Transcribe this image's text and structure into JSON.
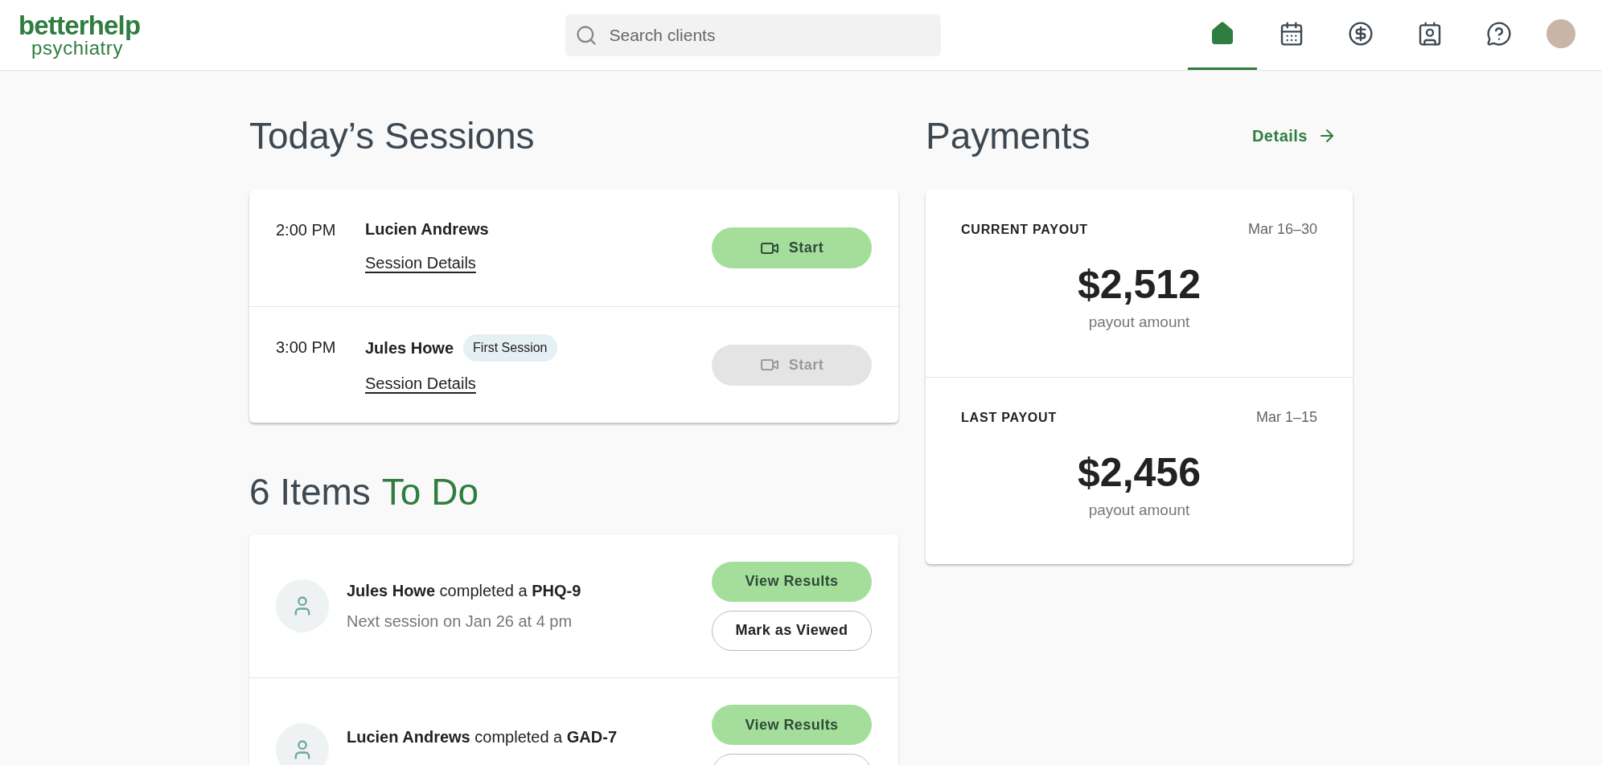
{
  "header": {
    "logo": {
      "line1": "betterhelp",
      "line2": "psychiatry"
    },
    "search": {
      "placeholder": "Search clients"
    },
    "nav": [
      {
        "kind": "home",
        "selected": true
      },
      {
        "kind": "calendar",
        "selected": false
      },
      {
        "kind": "dollar",
        "selected": false
      },
      {
        "kind": "contact",
        "selected": false
      },
      {
        "kind": "help",
        "selected": false
      },
      {
        "kind": "avatar",
        "selected": false
      }
    ]
  },
  "sessions": {
    "title": "Today’s Sessions",
    "rows": [
      {
        "time": "2:00 PM",
        "name": "Lucien Andrews",
        "link": "Session Details",
        "button": "Start",
        "enabled": true
      },
      {
        "time": "3:00 PM",
        "name": "Jules Howe",
        "badge": "First Session",
        "link": "Session Details",
        "button": "Start",
        "enabled": false
      }
    ]
  },
  "todo": {
    "count": "6 Items",
    "title": "To Do",
    "items": [
      {
        "text": "**Jules Howe** completed a **PHQ-9**",
        "subtitle": "Next session on Jan 26 at 4 pm",
        "actions": [
          {
            "kind": "primary",
            "label": "View Results"
          },
          {
            "kind": "secondary",
            "label": "Mark as Viewed"
          }
        ]
      },
      {
        "text": "**Lucien Andrews** completed a **GAD-7**",
        "actions": [
          {
            "kind": "primary",
            "label": "View Results"
          },
          {
            "kind": "secondary"
          }
        ]
      }
    ]
  },
  "payments": {
    "title": "Payments",
    "details_link": "Details",
    "sections": [
      {
        "label": "CURRENT PAYOUT",
        "period": "Mar 16–30",
        "amount": "$2,512",
        "caption": "payout amount"
      },
      {
        "label": "LAST PAYOUT",
        "period": "Mar 1–15",
        "amount": "$2,456",
        "caption": "payout amount"
      }
    ]
  }
}
